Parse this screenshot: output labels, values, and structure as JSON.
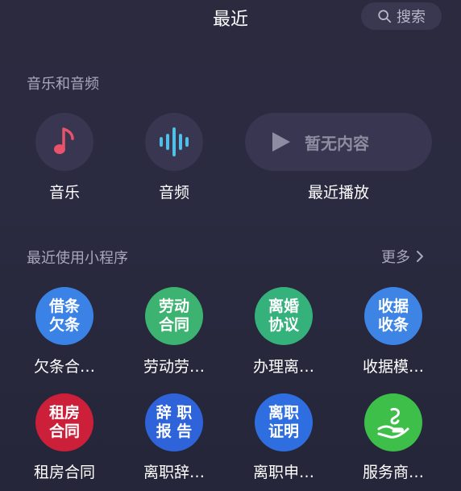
{
  "header": {
    "title": "最近",
    "search_label": "搜索"
  },
  "media_section": {
    "title": "音乐和音频",
    "items": [
      {
        "label": "音乐",
        "icon": "music-note-icon",
        "accent": "#e8526a"
      },
      {
        "label": "音频",
        "icon": "audio-wave-icon",
        "accent": "#4fc0e8"
      }
    ],
    "recent_play": {
      "empty_text": "暂无内容",
      "label": "最近播放",
      "icon": "play-icon"
    }
  },
  "mini_programs": {
    "title": "最近使用小程序",
    "more_label": "更多",
    "apps": [
      {
        "icon_line1": "借条",
        "icon_line2": "欠条",
        "label": "欠条合…",
        "color": "#3b82e6"
      },
      {
        "icon_line1": "劳动",
        "icon_line2": "合同",
        "label": "劳动劳…",
        "color": "#3cb371"
      },
      {
        "icon_line1": "离婚",
        "icon_line2": "协议",
        "label": "办理离…",
        "color": "#35b27c"
      },
      {
        "icon_line1": "收据",
        "icon_line2": "收条",
        "label": "收据模…",
        "color": "#3d84e4"
      },
      {
        "icon_line1": "租房",
        "icon_line2": "合同",
        "label": "租房合同",
        "color": "#cc1f3a"
      },
      {
        "icon_line1": "辞 职",
        "icon_line2": "报 告",
        "label": "离职辞…",
        "color": "#2f63d9"
      },
      {
        "icon_line1": "离职",
        "icon_line2": "证明",
        "label": "离职申…",
        "color": "#2f6ee0"
      },
      {
        "icon_line1": "",
        "icon_line2": "",
        "label": "服务商…",
        "color": "#3dbf4a"
      }
    ]
  }
}
